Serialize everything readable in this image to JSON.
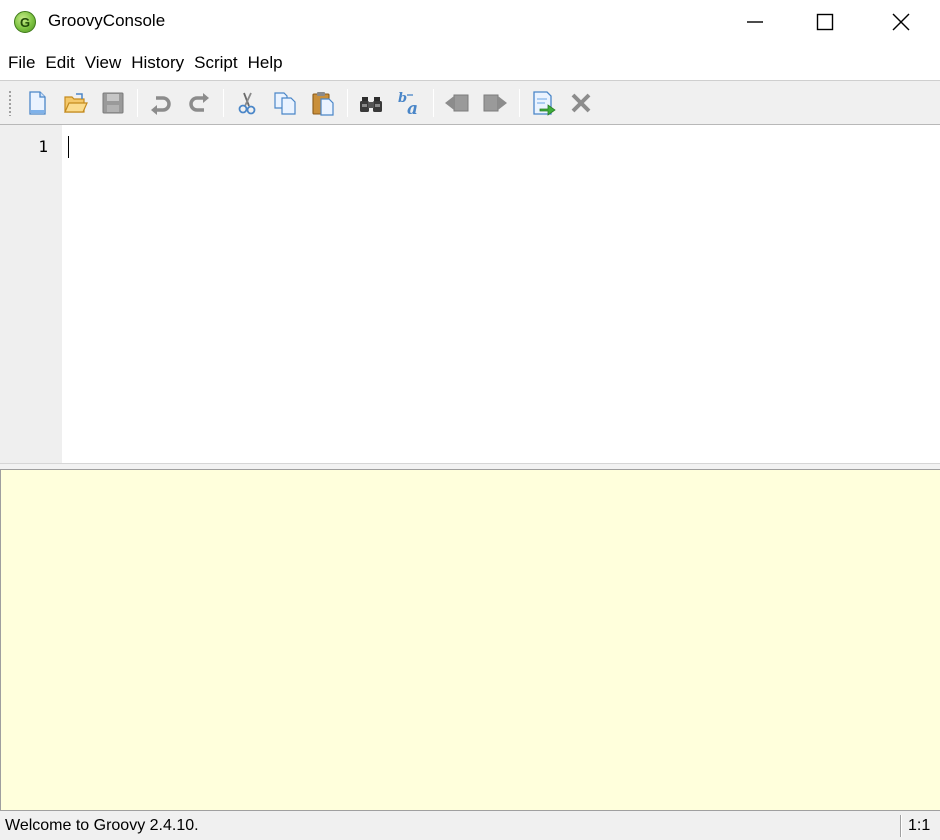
{
  "window": {
    "title": "GroovyConsole",
    "logo_letter": "G",
    "controls": [
      "minimize-icon",
      "maximize-icon",
      "close-icon"
    ]
  },
  "menu": {
    "items": [
      {
        "label": "File"
      },
      {
        "label": "Edit"
      },
      {
        "label": "View"
      },
      {
        "label": "History"
      },
      {
        "label": "Script"
      },
      {
        "label": "Help"
      }
    ]
  },
  "toolbar": {
    "buttons": [
      {
        "name": "new-file-icon",
        "enabled": true
      },
      {
        "name": "open-folder-icon",
        "enabled": true
      },
      {
        "name": "save-icon",
        "enabled": false
      },
      {
        "name": "undo-icon",
        "enabled": false
      },
      {
        "name": "redo-icon",
        "enabled": false
      },
      {
        "name": "cut-icon",
        "enabled": true
      },
      {
        "name": "copy-icon",
        "enabled": true
      },
      {
        "name": "paste-icon",
        "enabled": true
      },
      {
        "name": "find-binoculars-icon",
        "enabled": true
      },
      {
        "name": "replace-icon",
        "enabled": true
      },
      {
        "name": "history-previous-icon",
        "enabled": false
      },
      {
        "name": "history-next-icon",
        "enabled": false
      },
      {
        "name": "run-script-icon",
        "enabled": true
      },
      {
        "name": "interrupt-icon",
        "enabled": false
      }
    ]
  },
  "editor": {
    "line_numbers": [
      "1"
    ],
    "content": ""
  },
  "output": {
    "content": ""
  },
  "status": {
    "message": "Welcome to Groovy 2.4.10.",
    "caret_position": "1:1"
  },
  "colors": {
    "output_background": "#ffffdc",
    "gutter_background": "#efefef",
    "toolbar_background": "#f0f0f0",
    "icon_blue": "#4a86c8",
    "icon_disabled": "#8c8c8c"
  }
}
